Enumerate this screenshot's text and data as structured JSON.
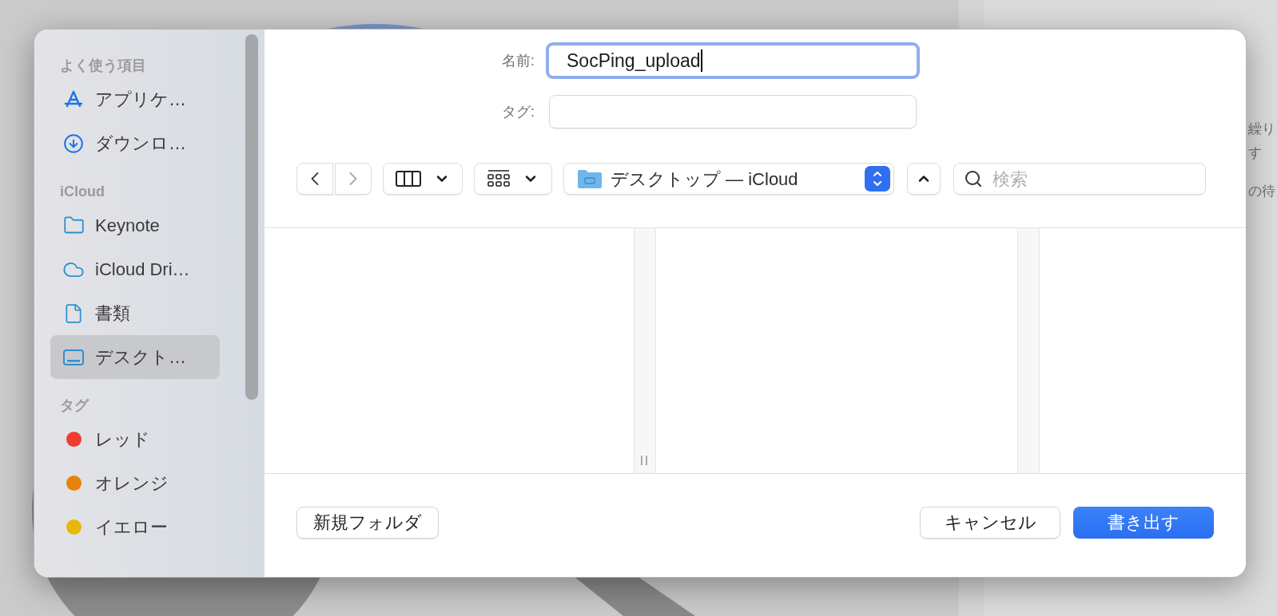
{
  "background_texts": [
    "繰り",
    "す",
    "の待"
  ],
  "sidebar": {
    "sections": [
      {
        "title": "よく使う項目",
        "items": [
          {
            "label": "アプリケ…",
            "kind": "apps",
            "selected": false
          },
          {
            "label": "ダウンロ…",
            "kind": "download",
            "selected": false
          }
        ]
      },
      {
        "title": "iCloud",
        "items": [
          {
            "label": "Keynote",
            "kind": "folder",
            "selected": false
          },
          {
            "label": "iCloud Dri…",
            "kind": "cloud",
            "selected": false
          },
          {
            "label": "書類",
            "kind": "document",
            "selected": false
          },
          {
            "label": "デスクト…",
            "kind": "desktop",
            "selected": true
          }
        ]
      },
      {
        "title": "タグ",
        "items": [
          {
            "label": "レッド",
            "kind": "tag",
            "color": "#f03b30",
            "selected": false
          },
          {
            "label": "オレンジ",
            "kind": "tag",
            "color": "#e8820c",
            "selected": false
          },
          {
            "label": "イエロー",
            "kind": "tag",
            "color": "#e8b70a",
            "selected": false
          }
        ]
      }
    ]
  },
  "name_field": {
    "label": "名前:",
    "value": "SocPing_upload",
    "focused": true
  },
  "tags_field": {
    "label": "タグ:"
  },
  "location": {
    "label": "デスクトップ — iCloud"
  },
  "search": {
    "placeholder": "検索"
  },
  "buttons": {
    "new_folder": "新規フォルダ",
    "cancel": "キャンセル",
    "save": "書き出す"
  }
}
